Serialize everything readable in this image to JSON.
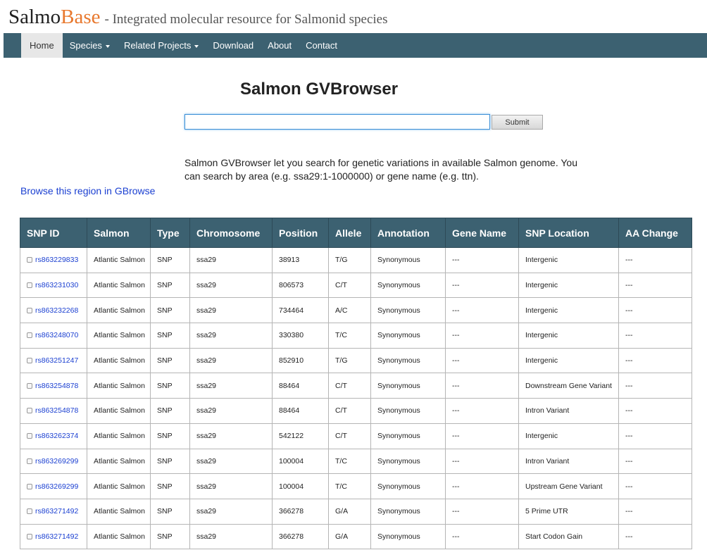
{
  "brand": {
    "name_part1": "Salmo",
    "name_part2": "Base",
    "tagline": "- Integrated molecular resource for Salmonid species"
  },
  "nav": {
    "items": [
      {
        "label": "Home",
        "active": true,
        "dropdown": false
      },
      {
        "label": "Species",
        "active": false,
        "dropdown": true
      },
      {
        "label": "Related Projects",
        "active": false,
        "dropdown": true
      },
      {
        "label": "Download",
        "active": false,
        "dropdown": false
      },
      {
        "label": "About",
        "active": false,
        "dropdown": false
      },
      {
        "label": "Contact",
        "active": false,
        "dropdown": false
      }
    ]
  },
  "page": {
    "title": "Salmon GVBrowser",
    "search_value": "",
    "submit_label": "Submit",
    "description": "Salmon GVBrowser let you search for genetic variations in available Salmon genome. You can search by area (e.g. ssa29:1-1000000) or gene name (e.g. ttn).",
    "gbrowse_link": "Browse this region in GBrowse"
  },
  "colors": {
    "navbar": "#3c6171",
    "accent_orange": "#e8792f",
    "link_blue": "#1a3fd1",
    "synonymous_green": "#2e8a2e",
    "intergenic_blue": "#3b7fc8",
    "variant_orange": "#e0742a"
  },
  "table": {
    "headers": [
      "SNP ID",
      "Salmon",
      "Type",
      "Chromosome",
      "Position",
      "Allele",
      "Annotation",
      "Gene Name",
      "SNP Location",
      "AA Change"
    ],
    "rows": [
      {
        "snp_id": "rs863229833",
        "salmon": "Atlantic Salmon",
        "type": "SNP",
        "chromosome": "ssa29",
        "position": "38913",
        "allele": "T/G",
        "annotation": "Synonymous",
        "gene_name": "---",
        "snp_location": "Intergenic",
        "location_style": "blue",
        "aa_change": "---"
      },
      {
        "snp_id": "rs863231030",
        "salmon": "Atlantic Salmon",
        "type": "SNP",
        "chromosome": "ssa29",
        "position": "806573",
        "allele": "C/T",
        "annotation": "Synonymous",
        "gene_name": "---",
        "snp_location": "Intergenic",
        "location_style": "blue",
        "aa_change": "---"
      },
      {
        "snp_id": "rs863232268",
        "salmon": "Atlantic Salmon",
        "type": "SNP",
        "chromosome": "ssa29",
        "position": "734464",
        "allele": "A/C",
        "annotation": "Synonymous",
        "gene_name": "---",
        "snp_location": "Intergenic",
        "location_style": "blue",
        "aa_change": "---"
      },
      {
        "snp_id": "rs863248070",
        "salmon": "Atlantic Salmon",
        "type": "SNP",
        "chromosome": "ssa29",
        "position": "330380",
        "allele": "T/C",
        "annotation": "Synonymous",
        "gene_name": "---",
        "snp_location": "Intergenic",
        "location_style": "blue",
        "aa_change": "---"
      },
      {
        "snp_id": "rs863251247",
        "salmon": "Atlantic Salmon",
        "type": "SNP",
        "chromosome": "ssa29",
        "position": "852910",
        "allele": "T/G",
        "annotation": "Synonymous",
        "gene_name": "---",
        "snp_location": "Intergenic",
        "location_style": "blue",
        "aa_change": "---"
      },
      {
        "snp_id": "rs863254878",
        "salmon": "Atlantic Salmon",
        "type": "SNP",
        "chromosome": "ssa29",
        "position": "88464",
        "allele": "C/T",
        "annotation": "Synonymous",
        "gene_name": "---",
        "snp_location": "Downstream Gene Variant",
        "location_style": "orange",
        "aa_change": "---"
      },
      {
        "snp_id": "rs863254878",
        "salmon": "Atlantic Salmon",
        "type": "SNP",
        "chromosome": "ssa29",
        "position": "88464",
        "allele": "C/T",
        "annotation": "Synonymous",
        "gene_name": "---",
        "snp_location": "Intron Variant",
        "location_style": "darkgreen",
        "aa_change": "---"
      },
      {
        "snp_id": "rs863262374",
        "salmon": "Atlantic Salmon",
        "type": "SNP",
        "chromosome": "ssa29",
        "position": "542122",
        "allele": "C/T",
        "annotation": "Synonymous",
        "gene_name": "---",
        "snp_location": "Intergenic",
        "location_style": "blue",
        "aa_change": "---"
      },
      {
        "snp_id": "rs863269299",
        "salmon": "Atlantic Salmon",
        "type": "SNP",
        "chromosome": "ssa29",
        "position": "100004",
        "allele": "T/C",
        "annotation": "Synonymous",
        "gene_name": "---",
        "snp_location": "Intron Variant",
        "location_style": "darkgreen",
        "aa_change": "---"
      },
      {
        "snp_id": "rs863269299",
        "salmon": "Atlantic Salmon",
        "type": "SNP",
        "chromosome": "ssa29",
        "position": "100004",
        "allele": "T/C",
        "annotation": "Synonymous",
        "gene_name": "---",
        "snp_location": "Upstream Gene Variant",
        "location_style": "orange",
        "aa_change": "---"
      },
      {
        "snp_id": "rs863271492",
        "salmon": "Atlantic Salmon",
        "type": "SNP",
        "chromosome": "ssa29",
        "position": "366278",
        "allele": "G/A",
        "annotation": "Synonymous",
        "gene_name": "---",
        "snp_location": "5 Prime UTR",
        "location_style": "gray",
        "aa_change": "---"
      },
      {
        "snp_id": "rs863271492",
        "salmon": "Atlantic Salmon",
        "type": "SNP",
        "chromosome": "ssa29",
        "position": "366278",
        "allele": "G/A",
        "annotation": "Synonymous",
        "gene_name": "---",
        "snp_location": "Start Codon Gain",
        "location_style": "gray",
        "aa_change": "---"
      }
    ]
  }
}
